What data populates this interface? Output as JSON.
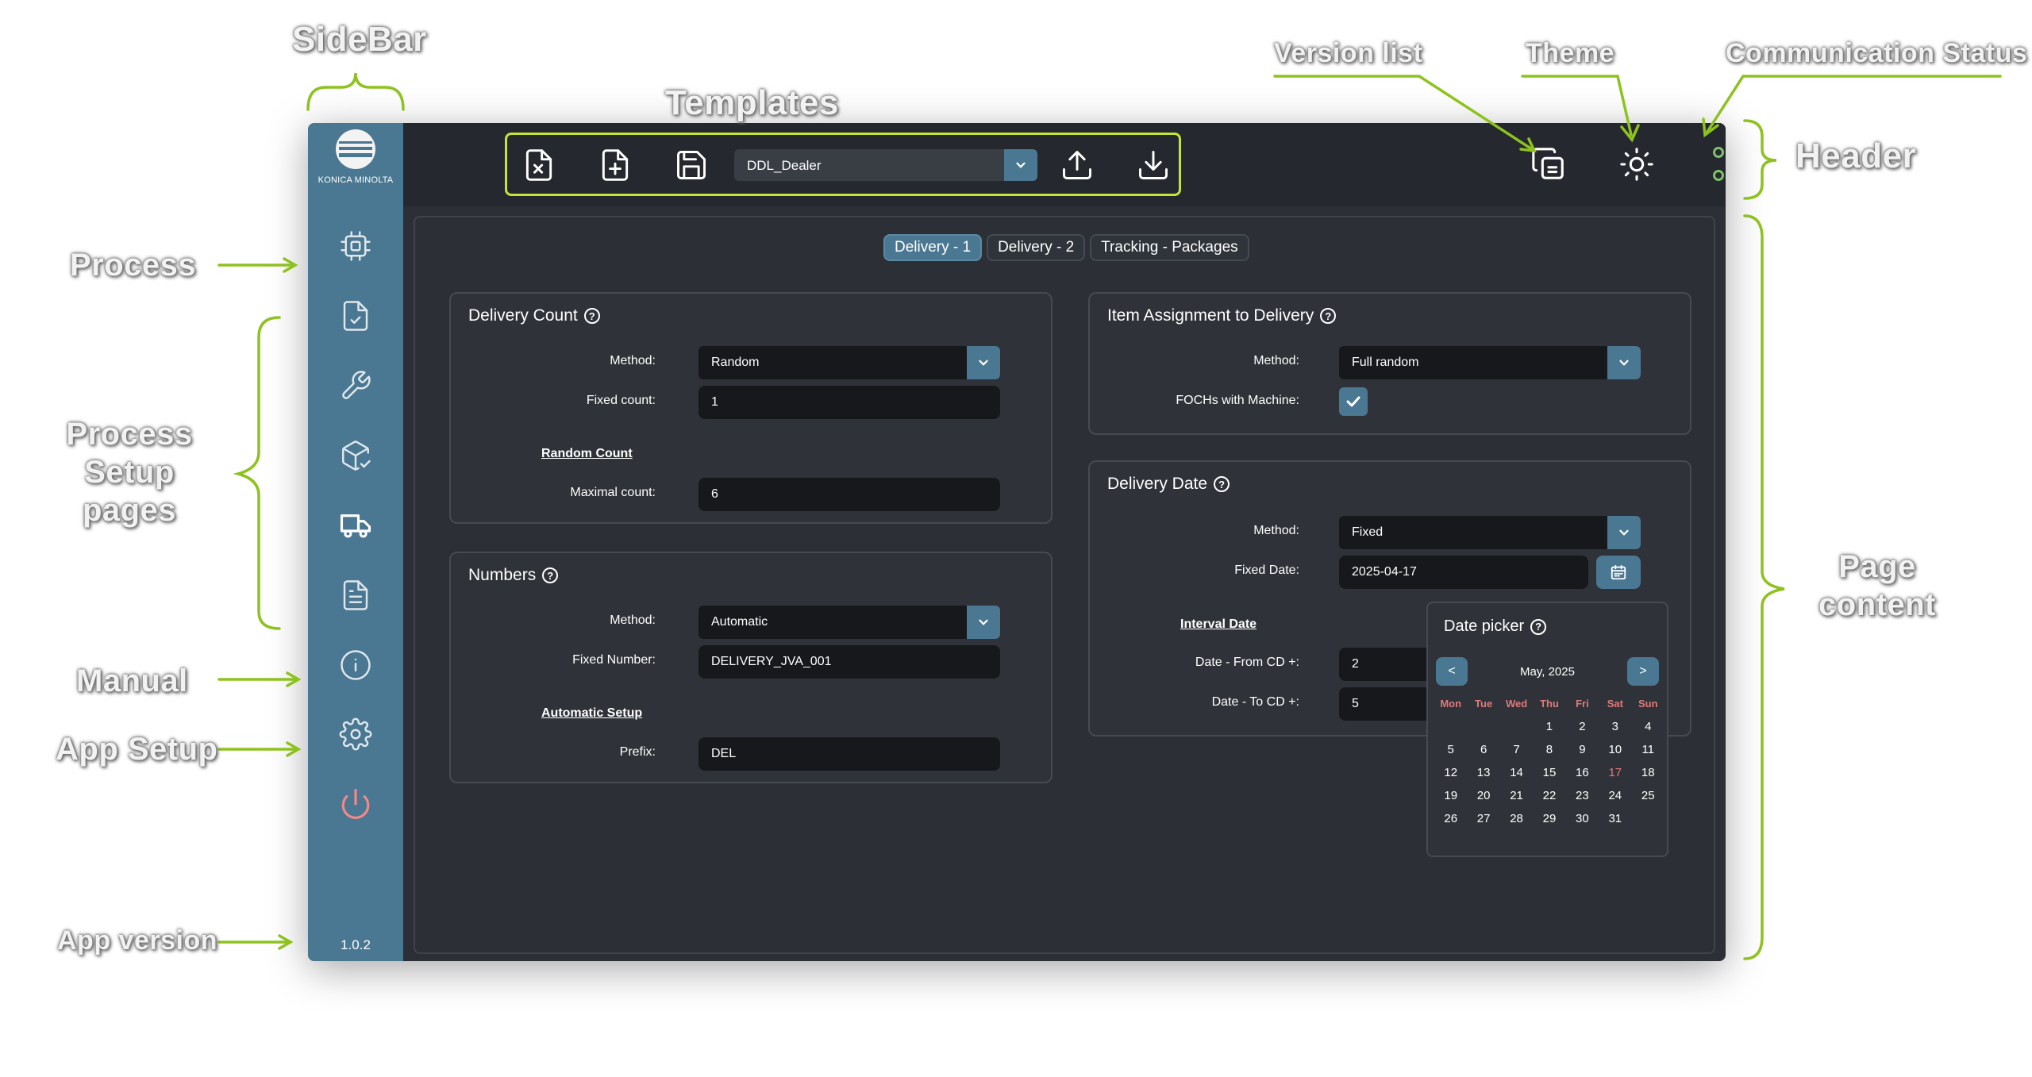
{
  "annotations": {
    "sidebar": "SideBar",
    "templates": "Templates",
    "version_list": "Version list",
    "theme": "Theme",
    "communication_status": "Communication Status",
    "header": "Header",
    "process": "Process",
    "process_setup_pages": [
      "Process",
      "Setup",
      "pages"
    ],
    "page_content": [
      "Page",
      "content"
    ],
    "manual": "Manual",
    "app_setup": "App Setup",
    "app_version": "App version",
    "accent_color": "#8dc21f"
  },
  "sidebar": {
    "logo_text": "KONICA MINOLTA",
    "items": [
      {
        "icon": "cpu-icon"
      },
      {
        "icon": "file-check-icon"
      },
      {
        "icon": "wrench-icon"
      },
      {
        "icon": "package-check-icon"
      },
      {
        "icon": "truck-icon"
      },
      {
        "icon": "document-icon"
      },
      {
        "icon": "info-icon"
      },
      {
        "icon": "gear-icon"
      },
      {
        "icon": "power-icon"
      }
    ],
    "app_version": "1.0.2"
  },
  "header": {
    "templates": {
      "selected_template": "DDL_Dealer",
      "buttons": [
        "close-file-icon",
        "new-file-icon",
        "save-icon",
        "upload-icon",
        "download-icon"
      ]
    },
    "icons": [
      "copy-versions-icon",
      "theme-icon"
    ],
    "status_color": "#7fc16a"
  },
  "tabs": [
    "Delivery - 1",
    "Delivery - 2",
    "Tracking - Packages"
  ],
  "delivery_count": {
    "title": "Delivery Count",
    "method_label": "Method:",
    "method_value": "Random",
    "fixed_count_label": "Fixed count:",
    "fixed_count_value": "1",
    "random_count_link": "Random Count",
    "maximal_count_label": "Maximal count:",
    "maximal_count_value": "6"
  },
  "numbers": {
    "title": "Numbers",
    "method_label": "Method:",
    "method_value": "Automatic",
    "fixed_number_label": "Fixed Number:",
    "fixed_number_value": "DELIVERY_JVA_001",
    "automatic_setup_link": "Automatic Setup",
    "prefix_label": "Prefix:",
    "prefix_value": "DEL"
  },
  "item_assignment": {
    "title": "Item Assignment to Delivery",
    "method_label": "Method:",
    "method_value": "Full random",
    "fochs_label": "FOCHs with Machine:",
    "fochs_checked": true
  },
  "delivery_date": {
    "title": "Delivery Date",
    "method_label": "Method:",
    "method_value": "Fixed",
    "fixed_date_label": "Fixed Date:",
    "fixed_date_value": "2025-04-17",
    "interval_date_link": "Interval Date",
    "date_from_label": "Date - From CD +:",
    "date_from_value": "2",
    "date_to_label": "Date - To CD +:",
    "date_to_value": "5"
  },
  "date_picker": {
    "title": "Date picker",
    "prev": "<",
    "next": ">",
    "month": "May, 2025",
    "weekdays": [
      "Mon",
      "Tue",
      "Wed",
      "Thu",
      "Fri",
      "Sat",
      "Sun"
    ],
    "weeks": [
      [
        "",
        "",
        "",
        "1",
        "2",
        "3",
        "4"
      ],
      [
        "5",
        "6",
        "7",
        "8",
        "9",
        "10",
        "11"
      ],
      [
        "12",
        "13",
        "14",
        "15",
        "16",
        "17",
        "18"
      ],
      [
        "19",
        "20",
        "21",
        "22",
        "23",
        "24",
        "25"
      ],
      [
        "26",
        "27",
        "28",
        "29",
        "30",
        "31",
        ""
      ]
    ],
    "highlighted_day": "17"
  }
}
